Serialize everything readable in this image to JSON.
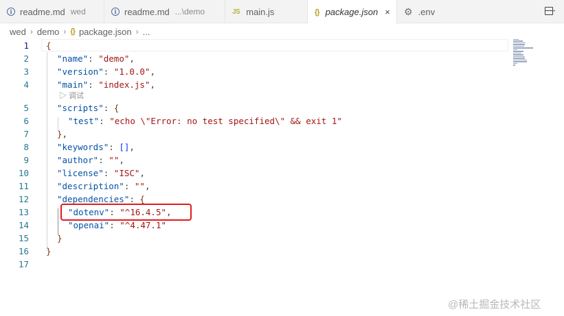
{
  "tabs": [
    {
      "icon": "info-icon",
      "label": "readme.md",
      "desc": "wed",
      "active": false
    },
    {
      "icon": "info-icon",
      "label": "readme.md",
      "desc": "...\\demo",
      "active": false
    },
    {
      "icon": "js-icon",
      "icon_text": "JS",
      "label": "main.js",
      "desc": "",
      "active": false
    },
    {
      "icon": "braces-icon",
      "icon_text": "{}",
      "label": "package.json",
      "desc": "",
      "active": true,
      "close": "×"
    },
    {
      "icon": "gear-icon",
      "label": ".env",
      "desc": "",
      "active": false
    }
  ],
  "breadcrumb": {
    "items": [
      "wed",
      "demo"
    ],
    "file_icon_text": "{}",
    "file": "package.json",
    "tail": "...",
    "separator": "›"
  },
  "codelens": "▷ 调试",
  "lines": [
    {
      "n": "1",
      "text": "{"
    },
    {
      "n": "2",
      "text": "\"name\": \"demo\","
    },
    {
      "n": "3",
      "text": "\"version\": \"1.0.0\","
    },
    {
      "n": "4",
      "text": "\"main\": \"index.js\","
    },
    {
      "n": "5",
      "text": "\"scripts\": {"
    },
    {
      "n": "6",
      "text": "\"test\": \"echo \\\"Error: no test specified\\\" && exit 1\""
    },
    {
      "n": "7",
      "text": "},"
    },
    {
      "n": "8",
      "text": "\"keywords\": [],"
    },
    {
      "n": "9",
      "text": "\"author\": \"\","
    },
    {
      "n": "10",
      "text": "\"license\": \"ISC\","
    },
    {
      "n": "11",
      "text": "\"description\": \"\","
    },
    {
      "n": "12",
      "text": "\"dependencies\": {"
    },
    {
      "n": "13",
      "text": "\"dotenv\": \"^16.4.5\","
    },
    {
      "n": "14",
      "text": "\"openai\": \"^4.47.1\""
    },
    {
      "n": "15",
      "text": "}"
    },
    {
      "n": "16",
      "text": "}"
    },
    {
      "n": "17",
      "text": ""
    }
  ],
  "watermark": "@稀土掘金技术社区",
  "colors": {
    "highlight_box": "#e3191c",
    "json_key": "#0451a5",
    "json_string": "#a31515",
    "line_number": "#237893"
  }
}
